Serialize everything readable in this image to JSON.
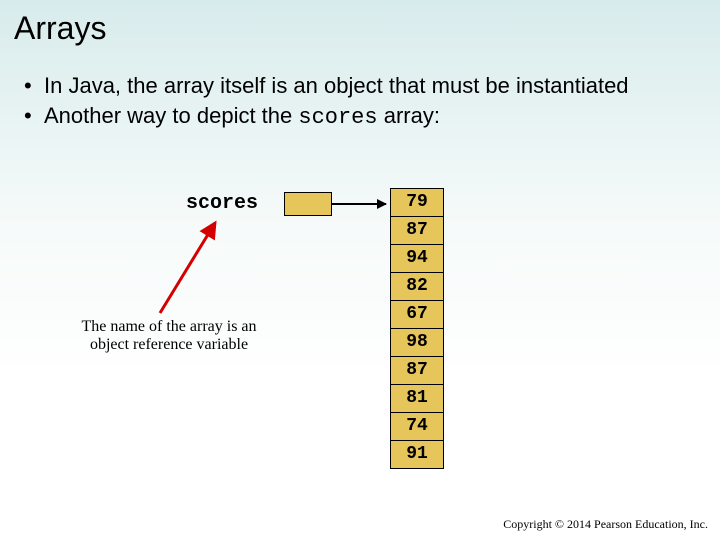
{
  "title": "Arrays",
  "bullets": {
    "b1": "In Java, the array itself is an object that must be instantiated",
    "b2_pre": "Another way to depict the ",
    "b2_code": "scores",
    "b2_post": " array:"
  },
  "diagram": {
    "scores_label": "scores",
    "caption": "The name of the array is an object reference variable",
    "cells": {
      "c0": "79",
      "c1": "87",
      "c2": "94",
      "c3": "82",
      "c4": "67",
      "c5": "98",
      "c6": "87",
      "c7": "81",
      "c8": "74",
      "c9": "91"
    }
  },
  "copyright": "Copyright © 2014 Pearson Education, Inc."
}
